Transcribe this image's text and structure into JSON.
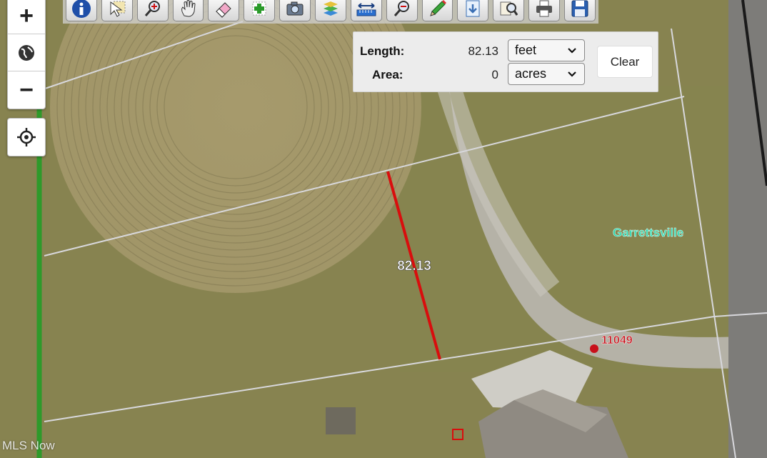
{
  "map": {
    "measurement_label": "82.13",
    "town_label": "Garrettsville",
    "parcel_label": "11049"
  },
  "controls": {
    "zoom_in": "+",
    "zoom_out": "−"
  },
  "toolbar": {
    "tools": [
      "info-icon",
      "select-icon",
      "zoom-in-tool-icon",
      "pan-hand-icon",
      "eraser-icon",
      "add-layer-icon",
      "camera-icon",
      "layers-icon",
      "measure-icon",
      "zoom-out-tool-icon",
      "pencil-icon",
      "export-icon",
      "identify-icon",
      "print-icon",
      "save-icon"
    ]
  },
  "measure": {
    "length_label": "Length:",
    "length_value": "82.13",
    "length_unit": "feet",
    "area_label": "Area:",
    "area_value": "0",
    "area_unit": "acres",
    "clear_label": "Clear"
  },
  "watermark": "MLS Now",
  "colors": {
    "measure_line": "#d90d0d",
    "parcel_lines": "#d8d8dc",
    "green_line": "#2e9a2a",
    "town_label": "#2fd7b0",
    "parcel_label": "#c8101a"
  }
}
